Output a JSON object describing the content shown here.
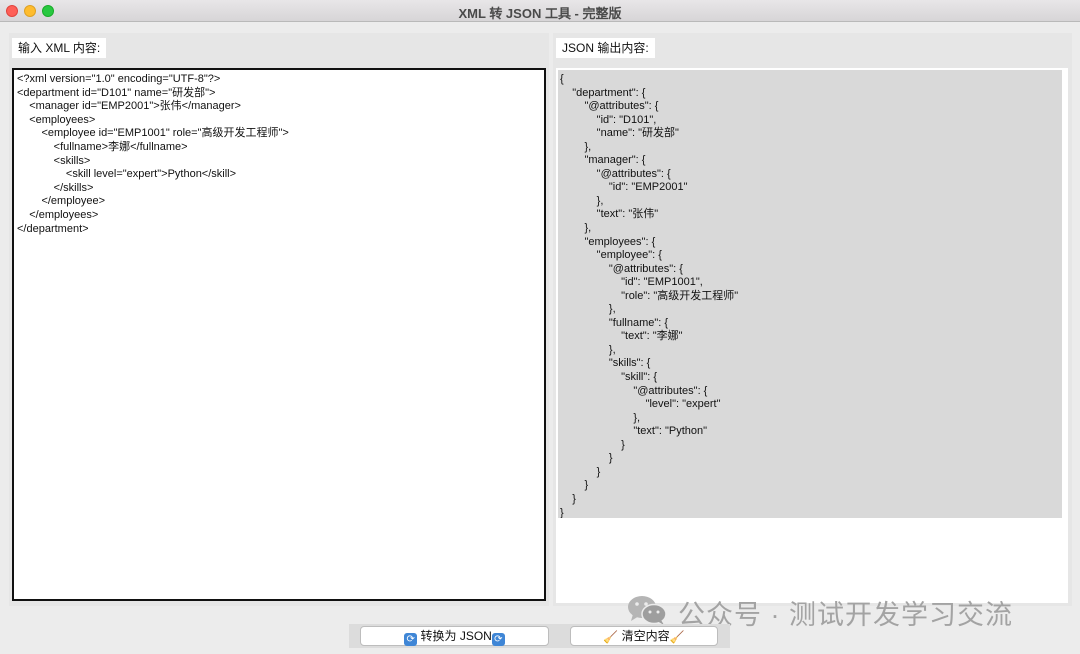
{
  "window": {
    "title": "XML 转 JSON 工具 - 完整版"
  },
  "left_pane": {
    "label": "输入 XML 内容:",
    "xml_text": "<?xml version=\"1.0\" encoding=\"UTF-8\"?>\n<department id=\"D101\" name=\"研发部\">\n    <manager id=\"EMP2001\">张伟</manager>\n    <employees>\n        <employee id=\"EMP1001\" role=\"高级开发工程师\">\n            <fullname>李娜</fullname>\n            <skills>\n                <skill level=\"expert\">Python</skill>\n            </skills>\n        </employee>\n    </employees>\n</department>"
  },
  "right_pane": {
    "label": "JSON 输出内容:",
    "json_text": "{\n    \"department\": {\n        \"@attributes\": {\n            \"id\": \"D101\",\n            \"name\": \"研发部\"\n        },\n        \"manager\": {\n            \"@attributes\": {\n                \"id\": \"EMP2001\"\n            },\n            \"text\": \"张伟\"\n        },\n        \"employees\": {\n            \"employee\": {\n                \"@attributes\": {\n                    \"id\": \"EMP1001\",\n                    \"role\": \"高级开发工程师\"\n                },\n                \"fullname\": {\n                    \"text\": \"李娜\"\n                },\n                \"skills\": {\n                    \"skill\": {\n                        \"@attributes\": {\n                            \"level\": \"expert\"\n                        },\n                        \"text\": \"Python\"\n                    }\n                }\n            }\n        }\n    }\n}"
  },
  "buttons": {
    "convert_label": "转换为 JSON",
    "clear_label": "清空内容"
  },
  "icons": {
    "refresh": "refresh-icon",
    "broom": "broom-icon",
    "wechat": "wechat-icon"
  },
  "watermark": {
    "text": "公众号 · 测试开发学习交流"
  },
  "colors": {
    "close": "#fe5f57",
    "minimize": "#febc2e",
    "maximize": "#28c840",
    "output_background": "#d9d9d9",
    "refresh_icon": "#3f86d6"
  }
}
